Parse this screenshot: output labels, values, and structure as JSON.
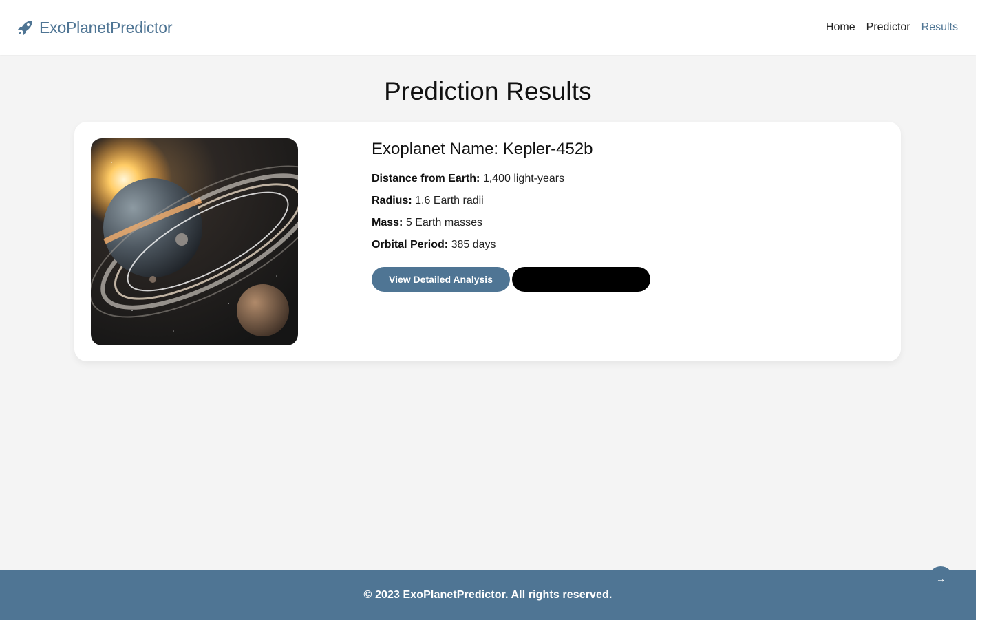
{
  "header": {
    "brand": "ExoPlanetPredictor",
    "brand_icon": "rocket-icon",
    "nav": [
      {
        "label": "Home",
        "active": false
      },
      {
        "label": "Predictor",
        "active": false
      },
      {
        "label": "Results",
        "active": true
      }
    ]
  },
  "main": {
    "title": "Prediction Results",
    "planet": {
      "image_icon": "planet-image",
      "name": "Exoplanet Name: Kepler-452b",
      "details": [
        {
          "label": "Distance from Earth:",
          "value": "1,400 light-years"
        },
        {
          "label": "Radius:",
          "value": "1.6 Earth radii"
        },
        {
          "label": "Mass:",
          "value": "5 Earth masses"
        },
        {
          "label": "Orbital Period:",
          "value": "385 days"
        }
      ]
    },
    "buttons": {
      "primary_label": "View Detailed Analysis",
      "secondary_label": ""
    }
  },
  "footer": {
    "text": "© 2023 ExoPlanetPredictor. All rights reserved.",
    "scroll_icon": "arrow-right-icon",
    "scroll_glyph": "→"
  },
  "colors": {
    "accent": "#4f7594",
    "background": "#f4f4f4",
    "card": "#ffffff",
    "dark_button": "#000000"
  }
}
